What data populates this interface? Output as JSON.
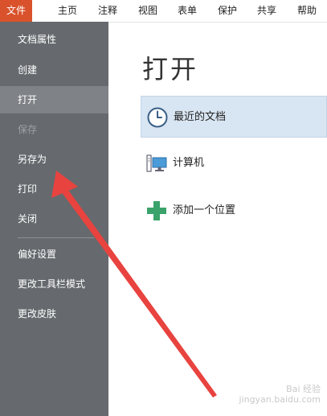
{
  "menubar": {
    "tabs": [
      {
        "label": "文件"
      },
      {
        "label": "主页"
      },
      {
        "label": "注释"
      },
      {
        "label": "视图"
      },
      {
        "label": "表单"
      },
      {
        "label": "保护"
      },
      {
        "label": "共享"
      },
      {
        "label": "帮助"
      }
    ],
    "active_tab": "文件"
  },
  "sidebar": {
    "items": [
      {
        "label": "文档属性"
      },
      {
        "label": "创建"
      },
      {
        "label": "打开"
      },
      {
        "label": "保存"
      },
      {
        "label": "另存为"
      },
      {
        "label": "打印"
      },
      {
        "label": "关闭"
      },
      {
        "label": "偏好设置"
      },
      {
        "label": "更改工具栏模式"
      },
      {
        "label": "更改皮肤"
      }
    ],
    "selected": "打开",
    "disabled": [
      "保存"
    ]
  },
  "main": {
    "title": "打开",
    "options": [
      {
        "label": "最近的文档",
        "icon": "clock-icon"
      },
      {
        "label": "计算机",
        "icon": "computer-icon"
      },
      {
        "label": "添加一个位置",
        "icon": "plus-icon"
      }
    ]
  },
  "watermark": {
    "line1": "Bai 经验",
    "line2": "jingyan.baidu.com"
  },
  "colors": {
    "active_tab": "#d9522b",
    "sidebar_bg": "#666a6e",
    "sidebar_selected": "#7f8286",
    "option_selected": "#d8e5f2",
    "arrow": "#e8433f",
    "plus": "#3aa36b"
  }
}
